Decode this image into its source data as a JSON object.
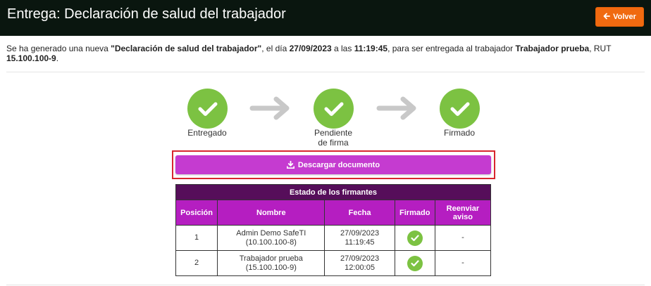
{
  "header": {
    "title": "Entrega: Declaración de salud del trabajador",
    "back_label": "Volver"
  },
  "intro": {
    "p1": "Se ha generado una nueva ",
    "doc_name": "\"Declaración de salud del trabajador\"",
    "p2": ", el día ",
    "date": "27/09/2023",
    "p3": " a las ",
    "time": "11:19:45",
    "p4": ", para ser entregada al trabajador ",
    "worker": "Trabajador prueba",
    "p5": ", RUT ",
    "rut": "15.100.100-9",
    "p6": "."
  },
  "steps": [
    {
      "label": "Entregado"
    },
    {
      "label_line1": "Pendiente",
      "label_line2": "de firma"
    },
    {
      "label": "Firmado"
    }
  ],
  "download": {
    "label": "Descargar documento"
  },
  "signers_table": {
    "caption": "Estado de los firmantes",
    "headers": {
      "position": "Posición",
      "name": "Nombre",
      "date": "Fecha",
      "signed": "Firmado",
      "resend_line1": "Reenviar",
      "resend_line2": "aviso"
    },
    "rows": [
      {
        "position": "1",
        "name": "Admin Demo SafeTI",
        "rut": "(10.100.100-8)",
        "date": "27/09/2023",
        "time": "11:19:45",
        "resend": "-"
      },
      {
        "position": "2",
        "name": "Trabajador prueba",
        "rut": "(15.100.100-9)",
        "date": "27/09/2023",
        "time": "12:00:05",
        "resend": "-"
      }
    ]
  },
  "colors": {
    "header_bg": "#0a160f",
    "back_button": "#f06a10",
    "step_green": "#7cc242",
    "arrow_gray": "#c8c8c8",
    "download_button": "#c53bd0",
    "highlight_frame": "#d8262e",
    "table_caption_bg": "#560e5a",
    "table_header_bg": "#b51ec1"
  },
  "icons": {
    "back": "arrow-left-icon",
    "step": "check-icon",
    "step_arrow": "arrow-right-icon",
    "download": "download-icon",
    "signed": "check-circle-icon"
  }
}
